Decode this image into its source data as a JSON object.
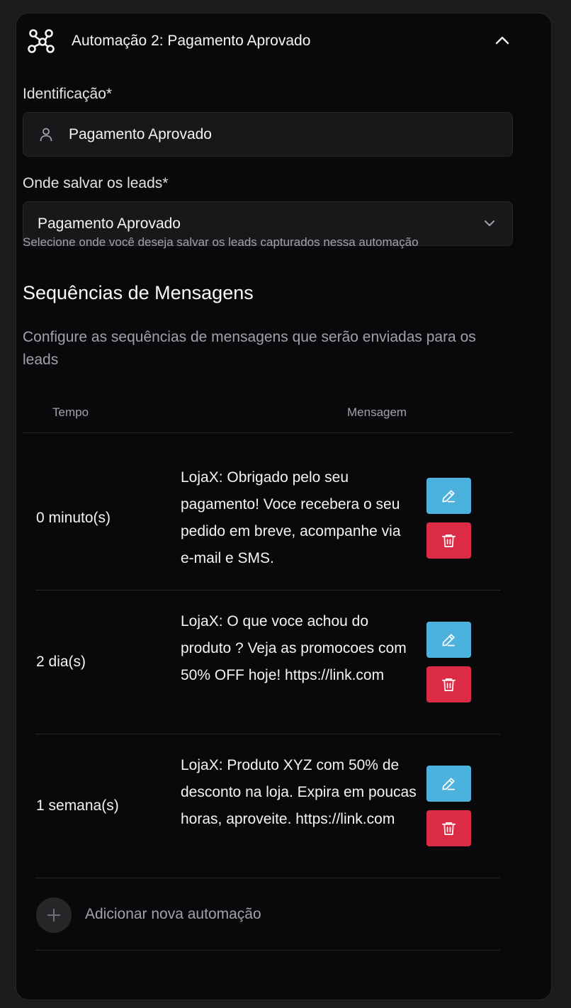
{
  "header": {
    "title": "Automação 2: Pagamento Aprovado",
    "logo_icon": "workflow-nodes-icon",
    "collapse_icon": "chevron-up-icon"
  },
  "identification": {
    "label": "Identificação*",
    "value": "Pagamento Aprovado",
    "icon": "user-icon"
  },
  "save_location": {
    "label": "Onde salvar os leads*",
    "selected": "Pagamento Aprovado",
    "icon": "chevron-down-icon",
    "hint": "Selecione onde você deseja salvar os leads capturados nessa automação"
  },
  "sequences": {
    "title": "Sequências de Mensagens",
    "description": "Configure as sequências de mensagens que serão enviadas para os leads",
    "columns": {
      "time": "Tempo",
      "message": "Mensagem"
    },
    "rows": [
      {
        "time": "0 minuto(s)",
        "message": "LojaX: Obrigado pelo seu pagamento! Voce recebera o seu pedido em breve, acompanhe via e-mail e SMS."
      },
      {
        "time": "2 dia(s)",
        "message": "LojaX: O que voce achou do produto ? Veja as promocoes com 50% OFF hoje! https://link.com"
      },
      {
        "time": "1 semana(s)",
        "message": "LojaX: Produto XYZ com 50% de desconto na loja. Expira em poucas horas, aproveite. https://link.com"
      }
    ],
    "add_label": "Adicionar nova automação"
  },
  "colors": {
    "edit": "#4cb1dc",
    "delete": "#dc2c45",
    "background": "#09090b"
  }
}
